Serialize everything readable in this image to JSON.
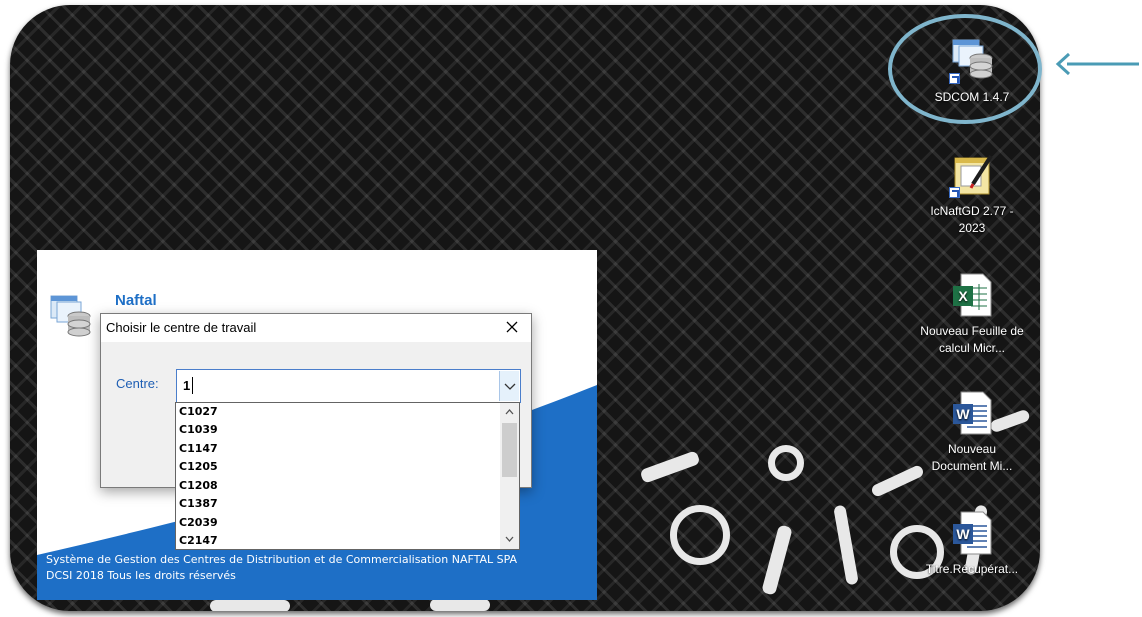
{
  "desktop": {
    "icons": [
      {
        "label": "SDCOM 1.4.7",
        "icon": "database-app-icon"
      },
      {
        "label": "IcNaftGD 2.77 - 2023",
        "icon": "notepad-pen-icon"
      },
      {
        "label": "Nouveau Feuille de calcul Micr...",
        "icon": "excel-icon"
      },
      {
        "label": "Nouveau Document Mi...",
        "icon": "word-icon"
      },
      {
        "label": "Titre.Récupérat...",
        "icon": "word-icon"
      }
    ]
  },
  "annotation": {
    "color": "#7fb5cc"
  },
  "splash": {
    "title": "Naftal",
    "footer_line1": "Système de Gestion des Centres de Distribution et de Commercialisation NAFTAL SPA",
    "footer_line2": "DCSI 2018 Tous les droits réservés",
    "accent": "#1e6fc6"
  },
  "dialog": {
    "title": "Choisir le centre de travail",
    "centre_label": "Centre:",
    "centre_value": "1",
    "options": [
      "C1027",
      "C1039",
      "C1147",
      "C1205",
      "C1208",
      "C1387",
      "C2039",
      "C2147"
    ]
  }
}
